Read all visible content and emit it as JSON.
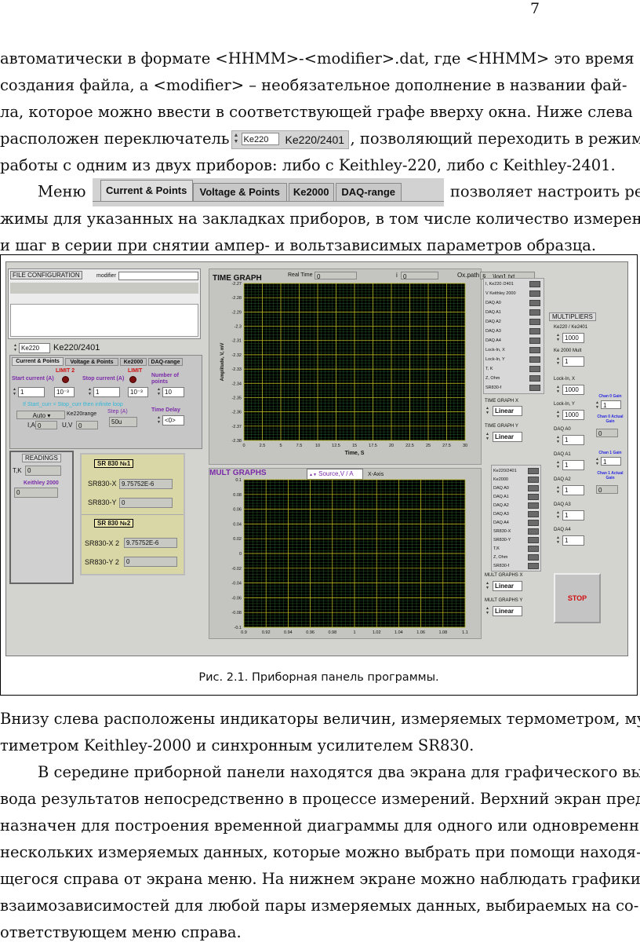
{
  "page_number": "7",
  "text_top": {
    "line1": "автоматически в формате <HHMM>-<modifier>.dat, где <HHMM> это время",
    "line2": "создания файла, а <modifier> – необязательное дополнение в названии фай-",
    "line3": "ла, которое можно ввести в соответствующей графе вверху окна. Ниже слева",
    "line4_before": "расположен переключатель",
    "line4_after": ", позволяющий переходить в режим",
    "line5": "работы с одним из двух приборов: либо с Keithley-220, либо с Keithley-2401.",
    "line6_before": "Меню",
    "line6_after": "позволяет настроить ре-",
    "line7": "жимы для указанных на закладках приборов, в том числе количество измерений",
    "line8": "и шаг в серии при снятии ампер- и вольтзависимых параметров образца."
  },
  "inline_switch": {
    "field": "Ke220",
    "label": "Ke220/2401"
  },
  "inline_menu": {
    "tabs": [
      "Current & Points",
      "Voltage & Points",
      "Ke2000",
      "DAQ-range"
    ]
  },
  "panel": {
    "file_config": {
      "title": "FILE CONFIGURATION",
      "modifier_label": "modifier",
      "modifier_value": ""
    },
    "device_switch": {
      "field": "Ke220",
      "label": "Ke220/2401"
    },
    "tabs": [
      "Current & Points",
      "Voltage & Points",
      "Ke2000",
      "DAQ-range"
    ],
    "current_points": {
      "limit2": "LIMIT 2",
      "limit": "LIMIT",
      "start_current_label": "Start current (A)",
      "start_current_value": "1",
      "start_exp": "10⁻³",
      "stop_current_label": "Stop current (A)",
      "stop_current_value": "1",
      "stop_exp": "10⁻³",
      "number_of_points_label": "Number of points",
      "number_of_points_value": "10",
      "infinite_note": "If Start_curr = Stop_curr then infinite loop",
      "range_select": "Auto",
      "range_label": "Ke220range",
      "step_label": "Step  (A)",
      "step_value": "50u",
      "time_delay_label": "Time Delay",
      "time_delay_value": "<0>",
      "ia_label": "I,A",
      "ia_value": "0",
      "uv_label": "U,V",
      "uv_value": "0"
    },
    "readings": {
      "title": "READINGS",
      "tk_label": "T,K",
      "tk_value": "0",
      "keithley_label": "Keithley 2000",
      "keithley_value": "0"
    },
    "sr830_1": {
      "title": "SR 830 №1",
      "x_label": "SR830-X",
      "x_value": "9.75752E-6",
      "y_label": "SR830-Y",
      "y_value": "0"
    },
    "sr830_2": {
      "title": "SR 830 №2",
      "x_label": "SR830-X 2",
      "x_value": "9.75752E-6",
      "y_label": "SR830-Y 2",
      "y_value": "0"
    },
    "time_graph": {
      "title": "TIME GRAPH",
      "real_time_label": "Real Time",
      "real_time_value": "0",
      "i_label": "i",
      "i_value": "0",
      "oxpath_label": "Ox.path",
      "oxpath_value": "§ ...\\log1.txt",
      "ylabel": "Amplitude, V, mV",
      "xlabel": "Time, S",
      "yticks": [
        "-2.27",
        "-2.28",
        "-2.29",
        "-2.3",
        "-2.31",
        "-2.32",
        "-2.33",
        "-2.34",
        "-2.35",
        "-2.36",
        "-2.37",
        "-2.38"
      ],
      "xticks": [
        "0",
        "2.5",
        "5",
        "7.5",
        "10",
        "12.5",
        "15",
        "17.5",
        "20",
        "22.5",
        "25",
        "27.5",
        "30"
      ],
      "legend": [
        "I, Ke220 /2401",
        "V Keithley 2000",
        "DAQ A0",
        "DAQ A1",
        "DAQ A2",
        "DAQ A3",
        "DAQ A4",
        "Lock-In, X",
        "Lock-In, Y",
        "T, K",
        "Z, Ohm",
        "SR830-f"
      ]
    },
    "mult_graphs": {
      "title": "MULT GRAPHS",
      "source_value": "Source,V  /  A",
      "x_axis_label": "X-Axis",
      "yticks": [
        "0.1",
        "0.08",
        "0.06",
        "0.04",
        "0.02",
        "0",
        "-0.02",
        "-0.04",
        "-0.06",
        "-0.08",
        "-0.1"
      ],
      "xticks": [
        "0.9",
        "0.92",
        "0.94",
        "0.96",
        "0.98",
        "1",
        "1.02",
        "1.04",
        "1.06",
        "1.08",
        "1.1"
      ],
      "legend": [
        "Ke220/2401",
        "Ke2000",
        "DAQ A0",
        "DAQ A1",
        "DAQ A2",
        "DAQ A3",
        "DAQ A4",
        "SR830-X",
        "SR830-Y",
        "T,K",
        "Z, Ohm",
        "SR830-f"
      ]
    },
    "scales": {
      "time_x_label": "TIME GRAPH X",
      "time_x_value": "Linear",
      "time_y_label": "TIME GRAPH Y",
      "time_y_value": "Linear",
      "mult_x_label": "MULT GRAPHS X",
      "mult_x_value": "Linear",
      "mult_y_label": "MULT GRAPHS Y",
      "mult_y_value": "Linear"
    },
    "multipliers": {
      "title": "MULTIPLIERS",
      "items": [
        {
          "label": "Ke220 / Ke2401",
          "value": "1000"
        },
        {
          "label": "Ke 2000 Mult",
          "value": "1"
        },
        {
          "label": "Lock-In, X",
          "value": "1000"
        },
        {
          "label": "Lock-In, Y",
          "value": "1000"
        },
        {
          "label": "DAQ A0",
          "value": "1"
        },
        {
          "label": "DAQ A1",
          "value": "1"
        },
        {
          "label": "DAQ A2",
          "value": "1"
        },
        {
          "label": "DAQ A3",
          "value": "1"
        },
        {
          "label": "DAQ A4",
          "value": "1"
        }
      ]
    },
    "gains": {
      "chan0_gain_label": "Chan 0 Gain",
      "chan0_gain_value": "1",
      "chan0_actual_label": "Chan 0 Actual Gain",
      "chan0_actual_value": "0",
      "chan1_gain_label": "Chan 1 Gain",
      "chan1_gain_value": "1",
      "chan1_actual_label": "Chan 1 Actual Gain",
      "chan1_actual_value": "0"
    },
    "stop_label": "STOP"
  },
  "caption": "Рис. 2.1. Приборная панель программы.",
  "text_bottom": {
    "line1": "Внизу слева расположены индикаторы величин, измеряемых термометром, муль-",
    "line2": "тиметром Keithley-2000 и синхронным усилителем SR830.",
    "line3": "В середине приборной панели находятся два экрана для графического вы-",
    "line4": "вода результатов непосредственно в процессе измерений. Верхний экран пред-",
    "line5": "назначен для построения временной диаграммы для одного или одновременно",
    "line6": "нескольких измеряемых данных, которые можно выбрать при помощи находя-",
    "line7": "щегося справа от экрана меню. На нижнем экране можно наблюдать графики",
    "line8": "взаимозависимостей для любой пары измеряемых данных, выбираемых на со-",
    "line9": "ответствующем меню справа."
  },
  "colors": {
    "panel_bg": "#d3d3cf",
    "plot_bg": "#000000",
    "grid_major": "#c8c820",
    "grid_minor": "#2e6b2e",
    "sr_panel": "#d9d7a6"
  }
}
